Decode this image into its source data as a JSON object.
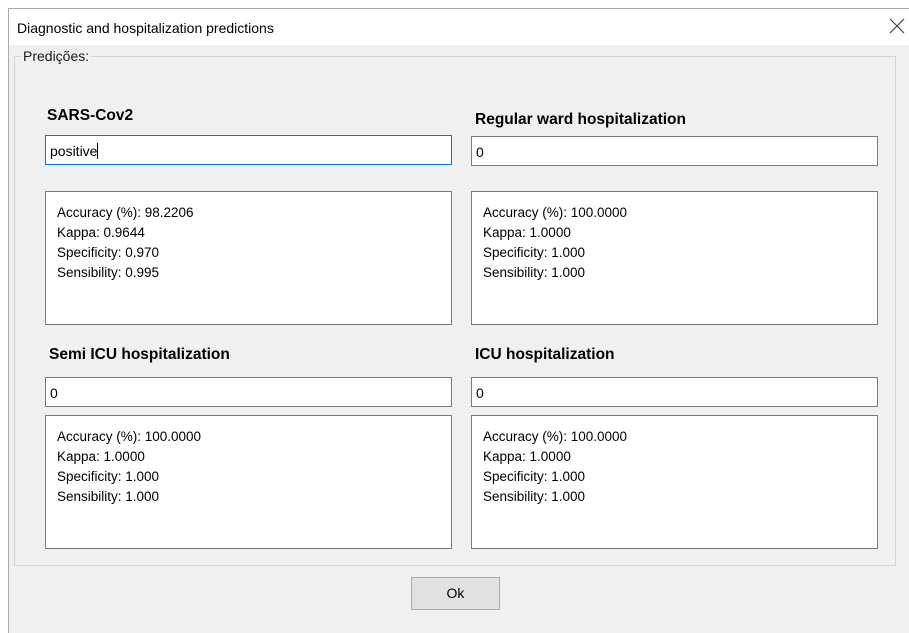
{
  "window": {
    "title": "Diagnostic and hospitalization predictions"
  },
  "group": {
    "legend": "Predições:"
  },
  "panels": [
    {
      "heading": "SARS-Cov2",
      "value": "positive",
      "metrics": [
        "Accuracy (%): 98.2206",
        "Kappa: 0.9644",
        "Specificity: 0.970",
        "Sensibility: 0.995"
      ]
    },
    {
      "heading": "Regular ward hospitalization",
      "value": "0",
      "metrics": [
        "Accuracy (%): 100.0000",
        "Kappa: 1.0000",
        "Specificity: 1.000",
        "Sensibility: 1.000"
      ]
    },
    {
      "heading": "Semi ICU hospitalization",
      "value": "0",
      "metrics": [
        "Accuracy (%): 100.0000",
        "Kappa: 1.0000",
        "Specificity: 1.000",
        "Sensibility: 1.000"
      ]
    },
    {
      "heading": "ICU hospitalization",
      "value": "0",
      "metrics": [
        "Accuracy (%): 100.0000",
        "Kappa: 1.0000",
        "Specificity: 1.000",
        "Sensibility: 1.000"
      ]
    }
  ],
  "buttons": {
    "ok_label": "Ok"
  },
  "icons": {
    "close": "close-icon"
  },
  "colors": {
    "focus_border": "#0078d7",
    "dialog_background": "#f0f0f0"
  }
}
